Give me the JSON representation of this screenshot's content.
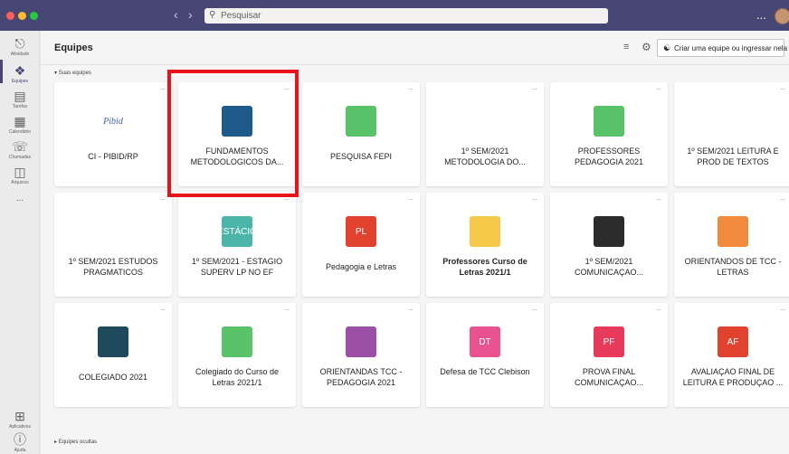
{
  "titlebar": {
    "search_placeholder": "Pesquisar",
    "back_icon": "chevron-left-icon",
    "forward_icon": "chevron-right-icon",
    "more_label": "..."
  },
  "rail": {
    "items": [
      {
        "label": "Atividade",
        "icon": "bell-icon"
      },
      {
        "label": "Equipes",
        "icon": "teams-icon"
      },
      {
        "label": "Tarefas",
        "icon": "clipboard-icon"
      },
      {
        "label": "Calendário",
        "icon": "calendar-icon"
      },
      {
        "label": "Chamadas",
        "icon": "phone-icon"
      },
      {
        "label": "Arquivos",
        "icon": "file-icon"
      },
      {
        "label": "...",
        "icon": "more-icon"
      },
      {
        "label": "Aplicativos",
        "icon": "apps-icon"
      },
      {
        "label": "Ajuda",
        "icon": "help-icon"
      }
    ]
  },
  "header": {
    "title": "Equipes",
    "create_label": "Criar uma equipe ou ingressar nela"
  },
  "sections": {
    "yours": "Suas equipes",
    "hidden": "Equipes ocultas"
  },
  "cards": [
    {
      "name": "CI - PIBID/RP",
      "thumb": "Pibid",
      "color": "#ffffff"
    },
    {
      "name": "FUNDAMENTOS METODOLOGICOS DA...",
      "thumb": "",
      "color": "#1e5a8c"
    },
    {
      "name": "PESQUISA FEPI",
      "thumb": "",
      "color": "#59c36a"
    },
    {
      "name": "1º SEM/2021 METODOLOGIA DO...",
      "thumb": "",
      "color": "#ffffff"
    },
    {
      "name": "PROFESSORES PEDAGOGIA 2021",
      "thumb": "",
      "color": "#59c36a"
    },
    {
      "name": "1º SEM/2021 LEITURA E PROD DE TEXTOS",
      "thumb": "",
      "color": "#ffffff"
    },
    {
      "name": "1º SEM/2021 ESTUDOS PRAGMATICOS",
      "thumb": "",
      "color": "#ffffff"
    },
    {
      "name": "1º SEM/2021 - ESTAGIO SUPERV LP NO EF",
      "thumb": "ESTÁCIO",
      "color": "#4ab5a8"
    },
    {
      "name": "Pedagogia e Letras",
      "thumb": "PL",
      "color": "#e0422e"
    },
    {
      "name": "Professores Curso de Letras 2021/1",
      "thumb": "",
      "color": "#f5c84a"
    },
    {
      "name": "1º SEM/2021 COMUNICAÇAO...",
      "thumb": "",
      "color": "#2b2b2b"
    },
    {
      "name": "ORIENTANDOS DE TCC - LETRAS",
      "thumb": "",
      "color": "#f08a3c"
    },
    {
      "name": "COLEGIADO 2021",
      "thumb": "",
      "color": "#1e4a5c"
    },
    {
      "name": "Colegiado do Curso de Letras 2021/1",
      "thumb": "",
      "color": "#59c36a"
    },
    {
      "name": "ORIENTANDAS TCC - PEDAGOGIA 2021",
      "thumb": "",
      "color": "#9b4fa5"
    },
    {
      "name": "Defesa de TCC Clebison",
      "thumb": "DT",
      "color": "#e8538f"
    },
    {
      "name": "PROVA FINAL COMUNICAÇAO...",
      "thumb": "PF",
      "color": "#e83a5a"
    },
    {
      "name": "AVALIAÇAO FINAL DE LEITURA E PRODUÇAO ...",
      "thumb": "AF",
      "color": "#e0422e"
    }
  ]
}
